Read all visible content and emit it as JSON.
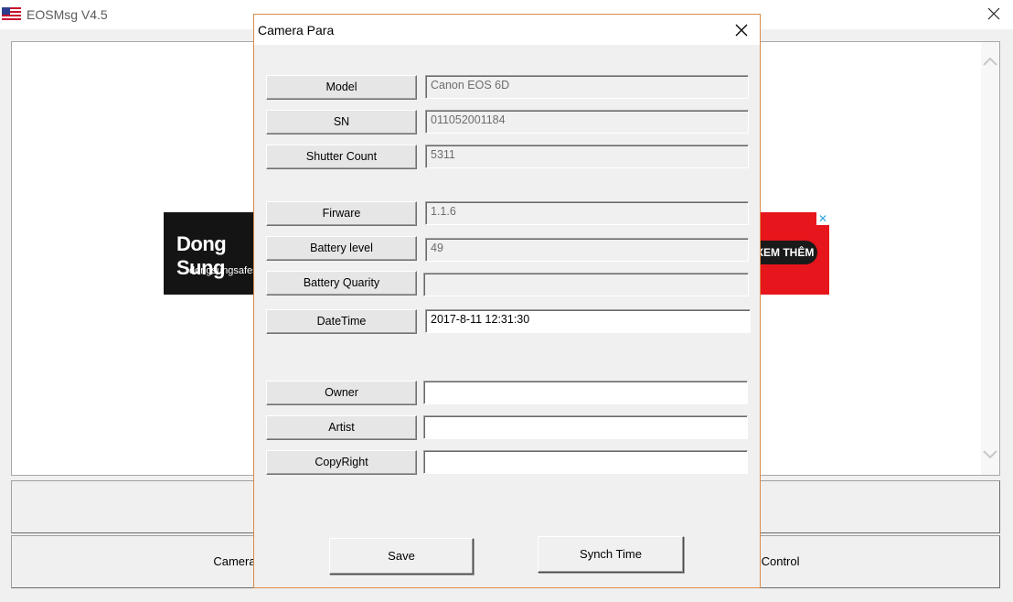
{
  "window": {
    "title": "EOSMsg V4.5",
    "flag_icon": "us-flag-icon",
    "close_icon": "close-icon"
  },
  "ad": {
    "brand": "Dong Sung",
    "url": "dongsungsafes.",
    "cta": "XEM THÊM",
    "close_icon": "close-x-icon",
    "colors": {
      "background": "#e6161c",
      "panel": "#141414"
    }
  },
  "main_buttons": {
    "camera_para": "Camera Para",
    "remote_control": "Remote Control"
  },
  "dialog": {
    "title": "Camera Para",
    "fields": {
      "model": {
        "label": "Model",
        "value": "Canon EOS 6D"
      },
      "sn": {
        "label": "SN",
        "value": "011052001184"
      },
      "shutter_count": {
        "label": "Shutter Count",
        "value": "5311"
      },
      "firmware": {
        "label": "Firware",
        "value": "1.1.6"
      },
      "battery_level": {
        "label": "Battery level",
        "value": "49"
      },
      "battery_quality": {
        "label": "Battery Quarity",
        "value": ""
      },
      "datetime": {
        "label": "DateTime",
        "value": "2017-8-11 12:31:30"
      },
      "owner": {
        "label": "Owner",
        "value": ""
      },
      "artist": {
        "label": "Artist",
        "value": ""
      },
      "copyright": {
        "label": "CopyRight",
        "value": ""
      }
    },
    "save_label": "Save",
    "synch_label": "Synch Time"
  }
}
